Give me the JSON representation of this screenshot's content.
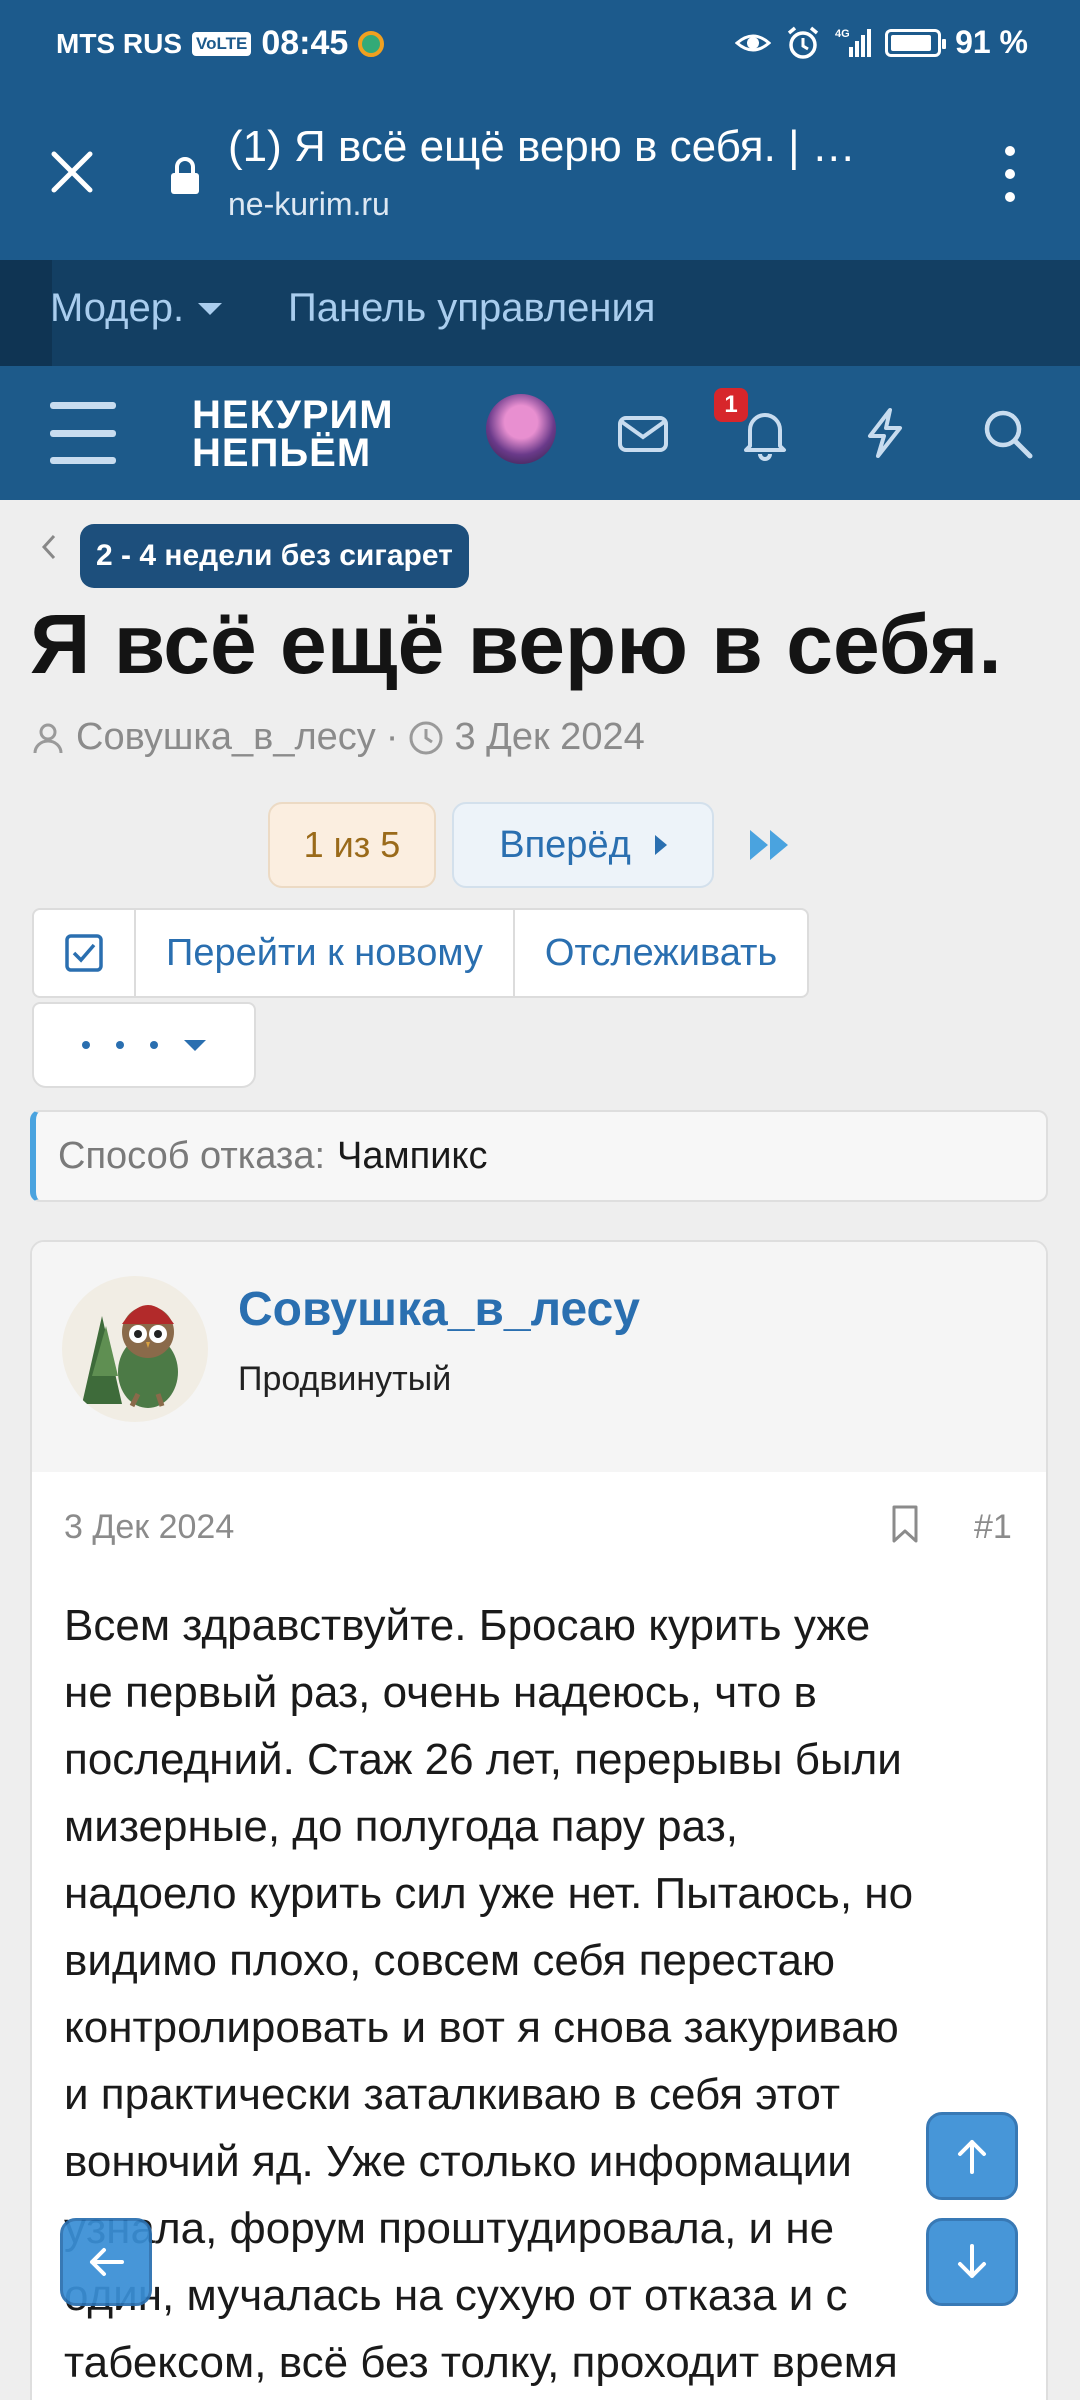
{
  "status_bar": {
    "carrier": "MTS RUS",
    "volte": "VoLTE",
    "time": "08:45",
    "network": "4G",
    "battery_percent": "91 %",
    "battery_level": 0.91
  },
  "browser": {
    "tab_title": "(1) Я всё ещё верю в себя. | …",
    "url": "ne-kurim.ru"
  },
  "mod_bar": {
    "moder_label": "Модер.",
    "panel_label": "Панель управления"
  },
  "site_header": {
    "logo_line1": "НЕКУРИМ",
    "logo_line2": "НЕПЬЁМ",
    "notifications_count": "1"
  },
  "thread": {
    "breadcrumb": "2 - 4 недели без сигарет",
    "title": "Я всё ещё верю в себя.",
    "author": "Совушка_в_лесу",
    "date": "3 Дек 2024",
    "separator": "·"
  },
  "pager": {
    "current": "1 из 5",
    "next_label": "Вперёд"
  },
  "actions": {
    "goto_new": "Перейти к новому",
    "watch": "Отслеживать"
  },
  "prefix": {
    "label": "Способ отказа:",
    "value": "Чампикс"
  },
  "post": {
    "username": "Совушка_в_лесу",
    "rank": "Продвинутый",
    "date": "3 Дек 2024",
    "number": "#1",
    "lines": [
      "Всем здравствуйте. Бросаю курить уже",
      "не первый раз, очень надеюсь, что в",
      "последний. Стаж 26 лет, перерывы были",
      "мизерные, до полугода пару раз,",
      "надоело курить сил уже нет. Пытаюсь, но",
      "видимо плохо, совсем себя перестаю",
      "контролировать и вот я снова закуриваю",
      "и практически заталкиваю в себя этот",
      "вонючий яд. Уже столько информации",
      "узнала, форум проштудировала, и не",
      "один, мучалась на сухую от отказа и с",
      "табексом, всё без толку, проходит время"
    ]
  },
  "colors": {
    "chrome": "#1c5a8c",
    "accent": "#2a6fb0",
    "badge": "#d7262b"
  }
}
